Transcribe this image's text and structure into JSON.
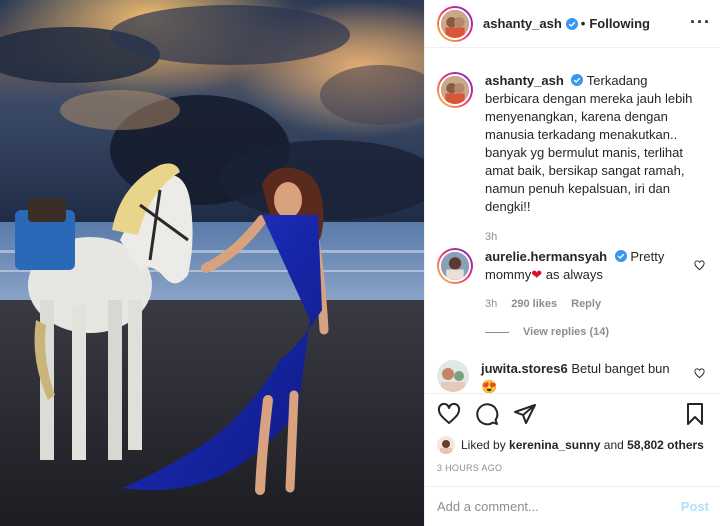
{
  "theme": {
    "accent": "#0095f6",
    "verified": "#3897f0",
    "muted_text": "#8e8e8e",
    "like_red": "#ed4956"
  },
  "photo": {
    "icon": "photo-horse-woman-beach"
  },
  "header": {
    "username": "ashanty_ash",
    "separator": "•",
    "follow_status": "Following",
    "more_icon": "more-options-icon"
  },
  "caption": {
    "username": "ashanty_ash",
    "text": "Terkadang berbicara dengan mereka jauh lebih menyenangkan, karena dengan manusia terkadang menakutkan.. banyak yg bermulut manis, terlihat amat baik, bersikap sangat ramah, namun penuh kepalsuan, iri dan dengki!!",
    "time": "3h"
  },
  "comments": [
    {
      "username": "aurelie.hermansyah",
      "text_before_emoji": "Pretty mommy",
      "emoji": "❤",
      "text_after_emoji": "as always",
      "time": "3h",
      "likes": "290 likes",
      "reply_label": "Reply",
      "view_replies": "View replies (14)"
    },
    {
      "username": "juwita.stores6",
      "text": "Betul banget bun",
      "emoji": "😍"
    }
  ],
  "actions": {
    "like_icon": "heart-icon",
    "comment_icon": "comment-icon",
    "share_icon": "share-icon",
    "save_icon": "bookmark-icon"
  },
  "likes_summary": {
    "prefix": "Liked by",
    "user": "kerenina_sunny",
    "connector": "and",
    "others": "58,802 others"
  },
  "timestamp": "3 HOURS AGO",
  "add_comment": {
    "placeholder": "Add a comment...",
    "post_label": "Post"
  }
}
